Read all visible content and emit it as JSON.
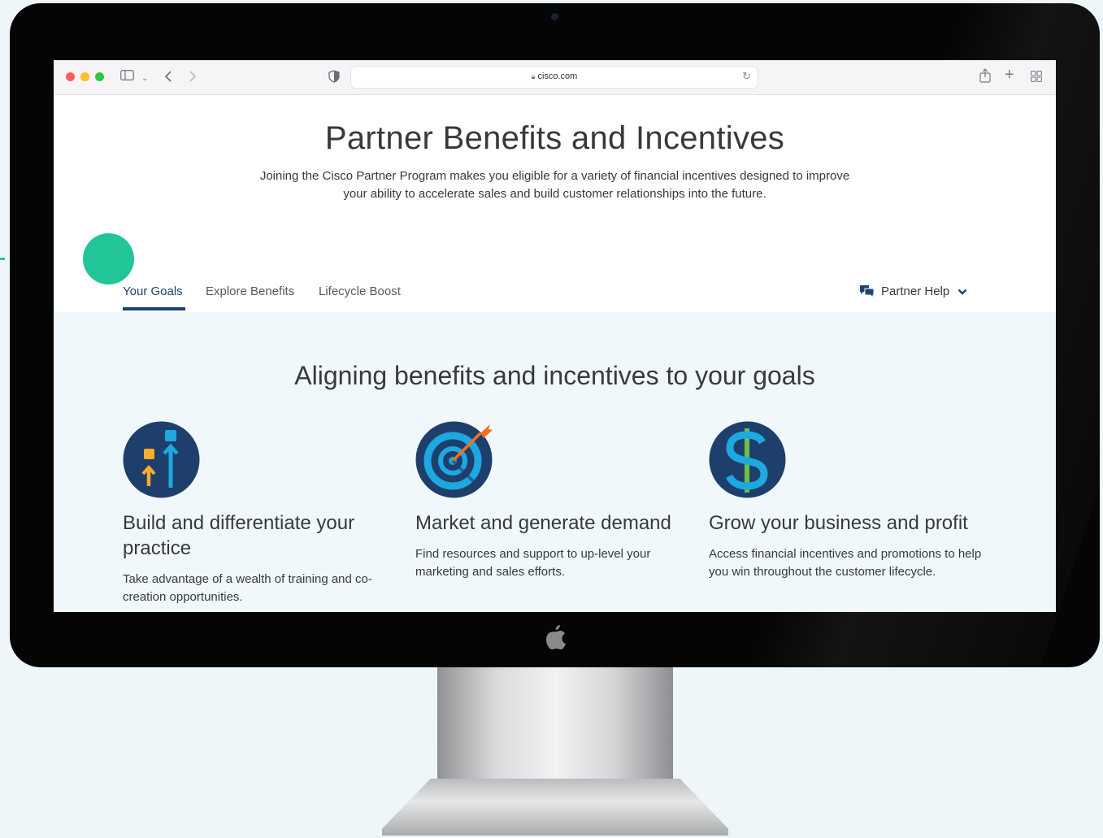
{
  "browser": {
    "url": "cisco.com"
  },
  "page": {
    "title": "Partner Benefits and Incentives",
    "subtitle": "Joining the Cisco Partner Program makes you eligible for a variety of financial incentives designed to improve your ability to accelerate sales and build customer relationships into the future."
  },
  "tabs": [
    {
      "label": "Your Goals",
      "active": true
    },
    {
      "label": "Explore Benefits",
      "active": false
    },
    {
      "label": "Lifecycle Boost",
      "active": false
    }
  ],
  "help": {
    "label": "Partner Help"
  },
  "goals": {
    "heading": "Aligning benefits and incentives to your goals",
    "cards": [
      {
        "icon": "growth-arrows-icon",
        "title": "Build and differentiate your practice",
        "description": "Take advantage of a wealth of training and co-creation opportunities."
      },
      {
        "icon": "target-icon",
        "title": "Market and generate demand",
        "description": "Find resources and support to up-level your marketing and sales efforts."
      },
      {
        "icon": "dollar-icon",
        "title": "Grow your business and profit",
        "description": "Access financial incentives and promotions to help you win throughout the customer lifecycle."
      }
    ]
  },
  "colors": {
    "accent_green": "#22c597",
    "brand_navy": "#1e4471",
    "band_bg": "#f0f8fb"
  }
}
